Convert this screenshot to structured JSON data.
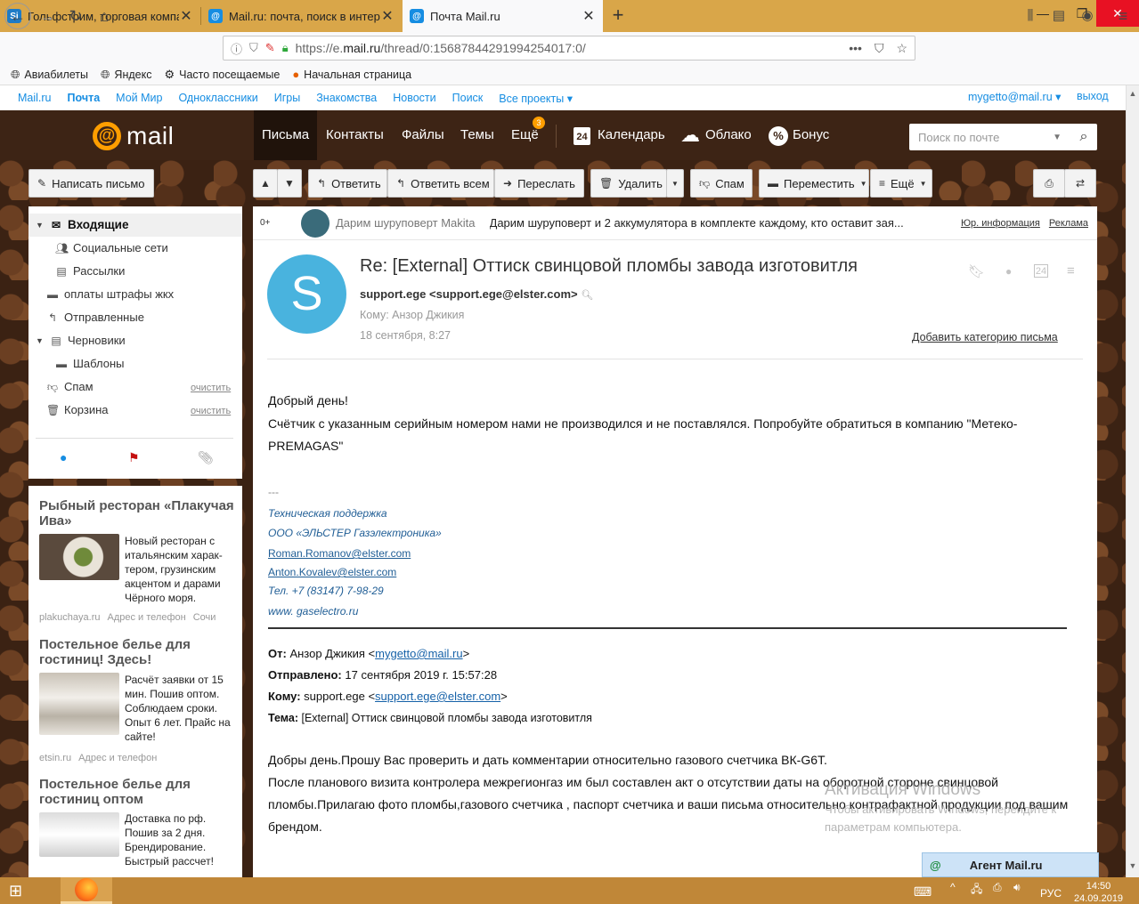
{
  "tabs": [
    {
      "label": "Гольфстрим, торговая компан",
      "icon": "Si",
      "color": "#1e7bc6"
    },
    {
      "label": "Mail.ru: почта, поиск в интерн",
      "icon": "@",
      "color": "#168de2"
    },
    {
      "label": "Почта Mail.ru",
      "icon": "@",
      "color": "#168de2"
    }
  ],
  "address": {
    "prefix": "https://e.",
    "domain": "mail.ru",
    "path": "/thread/0:15687844291994254017:0/"
  },
  "bookmarks": [
    "Авиабилеты",
    "Яндекс",
    "Часто посещаемые",
    "Начальная страница"
  ],
  "portal": {
    "items": [
      "Mail.ru",
      "Почта",
      "Мой Мир",
      "Одноклассники",
      "Игры",
      "Знакомства",
      "Новости",
      "Поиск",
      "Все проекты"
    ],
    "account": "mygetto@mail.ru",
    "logout": "выход"
  },
  "header": {
    "logo": "mail",
    "nav": [
      "Письма",
      "Контакты",
      "Файлы",
      "Темы",
      "Ещё"
    ],
    "badge": "3",
    "calendar": "Календарь",
    "cloud": "Облако",
    "bonus": "Бонус",
    "calendar_day": "24",
    "search_placeholder": "Поиск по почте"
  },
  "toolbar": {
    "compose": "Написать письмо",
    "reply": "Ответить",
    "reply_all": "Ответить всем",
    "forward": "Переслать",
    "delete": "Удалить",
    "spam": "Спам",
    "move": "Переместить",
    "more": "Ещё"
  },
  "folders": [
    {
      "label": "Входящие"
    },
    {
      "label": "Социальные сети"
    },
    {
      "label": "Рассылки"
    },
    {
      "label": "оплаты штрафы жкх"
    },
    {
      "label": "Отправленные"
    },
    {
      "label": "Черновики"
    },
    {
      "label": "Шаблоны"
    },
    {
      "label": "Спам",
      "action": "очистить"
    },
    {
      "label": "Корзина",
      "action": "очистить"
    }
  ],
  "ads": [
    {
      "title": "Рыбный ресторан «Плакучая Ива»",
      "text": "Новый ресторан с итальянским харак-тером, грузинским акцентом и дарами Чёрного моря.",
      "domain": "plakuchaya.ru",
      "addr": "Адрес и телефон",
      "extra": "Сочи"
    },
    {
      "title": "Постельное белье для гостиниц! Здесь!",
      "text": "Расчёт заявки от 15 мин. Пошив оптом. Соблюдаем сроки. Опыт 6 лет. Прайс на сайте!",
      "domain": "etsin.ru",
      "addr": "Адрес и телефон",
      "extra": ""
    },
    {
      "title": "Постельное белье для гостиниц оптом",
      "text": "Доставка по рф. Пошив за 2 дня. Брендирование. Быстрый рассчет!",
      "domain": "",
      "addr": "",
      "extra": ""
    }
  ],
  "promo": {
    "count": "0+",
    "sender": "Дарим шуруповерт Makita",
    "subject": "Дарим шуруповерт и 2 аккумулятора в комплекте каждому, кто оставит зая...",
    "legal": "Юр. информация",
    "ad": "Реклама"
  },
  "message": {
    "avatar": "S",
    "subject": "Re: [External] Оттиск свинцовой пломбы завода изготовитля",
    "from_name": "support.ege",
    "from_email": "<support.ege@elster.com>",
    "to": "Кому: Анзор Джикия",
    "date": "18 сентября, 8:27",
    "add_category": "Добавить категорию письма",
    "calendar_day": "24",
    "greeting": "Добрый день!",
    "line1": "Счётчик с указанным серийным номером нами не производился и не поставлялся. Попробуйте обратиться в компанию \"Метеко-PREMAGAS\"",
    "sig_dash": "---",
    "sig_dept": "Техническая поддержка",
    "sig_company": "ООО «ЭЛЬСТЕР Газэлектроника»",
    "sig_email1": "Roman.Romanov@elster.com",
    "sig_email2": "Anton.Kovalev@elster.com",
    "sig_phone": "Тел. +7 (83147) 7-98-29",
    "sig_web": "www. gaselectro.ru",
    "q_from_label": "От:",
    "q_from_name": "Анзор Джикия <",
    "q_from_email": "mygetto@mail.ru",
    "q_close": ">",
    "q_sent_label": "Отправлено:",
    "q_sent": "17 сентября 2019 г. 15:57:28",
    "q_to_label": "Кому:",
    "q_to_name": "support.ege <",
    "q_to_email": "support.ege@elster.com",
    "q_subj_label": "Тема:",
    "q_subj": "[External] Оттиск свинцовой пломбы завода изготовитля",
    "q_line1": "Добры день.Прошу Вас проверить и дать комментарии относительно газового счетчика ВК-G6T.",
    "q_line2": "После планового визита контролера межрегионгаз им был составлен акт о отсутствии даты на оборотной стороне свинцовой пломбы.Прилагаю фото пломбы,газового счетчика , паспорт счетчика и ваши письма относительно контрафактной продукции под вашим брендом."
  },
  "watermark": {
    "title": "Активация Windows",
    "text": "Чтобы активировать Windows, перейдите к параметрам компьютера."
  },
  "agent": {
    "icon": "@",
    "label": "Агент Mail.ru"
  },
  "taskbar": {
    "lang": "РУС",
    "time": "14:50",
    "date": "24.09.2019"
  }
}
